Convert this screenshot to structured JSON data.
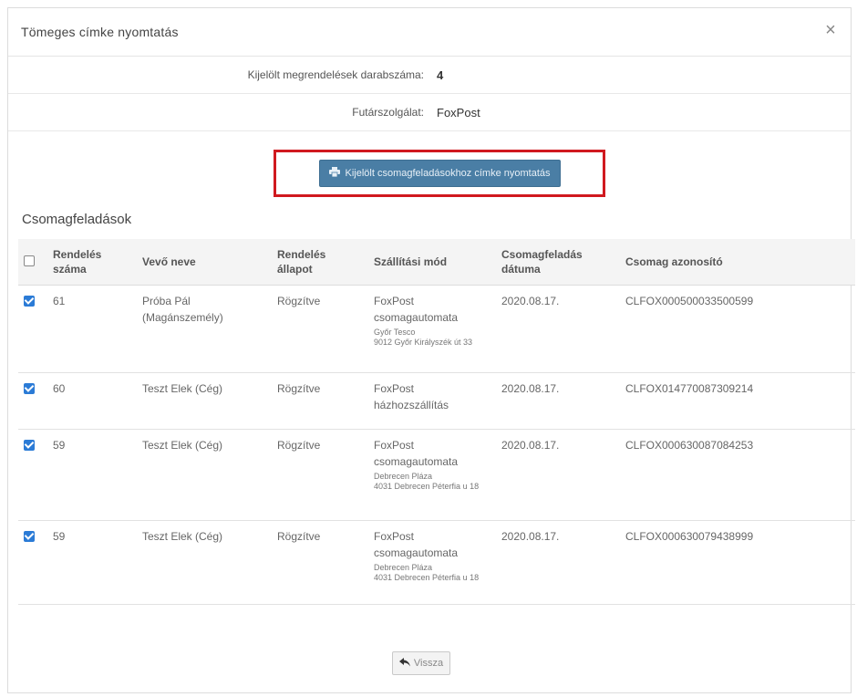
{
  "modal": {
    "title": "Tömeges címke nyomtatás",
    "close_label": "×"
  },
  "info": {
    "count_label": "Kijelölt megrendelések darabszáma:",
    "count_value": "4",
    "courier_label": "Futárszolgálat:",
    "courier_value": "FoxPost"
  },
  "print_button": {
    "label": "Kijelölt csomagfeladásokhoz címke nyomtatás",
    "icon": "printer-icon"
  },
  "section_title": "Csomagfeladások",
  "table": {
    "headers": [
      "Rendelés száma",
      "Vevő neve",
      "Rendelés állapot",
      "Szállítási mód",
      "Csomagfeladás dátuma",
      "Csomag azonosító"
    ],
    "header_checked": false,
    "rows": [
      {
        "checked": true,
        "number": "61",
        "name": "Próba Pál (Magánszemély)",
        "state": "Rögzítve",
        "ship": "FoxPost csomagautomata",
        "ship_detail1": "Győr Tesco",
        "ship_detail2": "9012 Győr Királyszék út 33",
        "date": "2020.08.17.",
        "id": "CLFOX000500033500599"
      },
      {
        "checked": true,
        "number": "60",
        "name": "Teszt Elek (Cég)",
        "state": "Rögzítve",
        "ship": "FoxPost házhozszállítás",
        "ship_detail1": "",
        "ship_detail2": "",
        "date": "2020.08.17.",
        "id": "CLFOX014770087309214"
      },
      {
        "checked": true,
        "number": "59",
        "name": "Teszt Elek (Cég)",
        "state": "Rögzítve",
        "ship": "FoxPost csomagautomata",
        "ship_detail1": "Debrecen Pláza",
        "ship_detail2": "4031 Debrecen Péterfia u 18",
        "date": "2020.08.17.",
        "id": "CLFOX000630087084253"
      },
      {
        "checked": true,
        "number": "59",
        "name": "Teszt Elek (Cég)",
        "state": "Rögzítve",
        "ship": "FoxPost csomagautomata",
        "ship_detail1": "Debrecen Pláza",
        "ship_detail2": "4031 Debrecen Péterfia u 18",
        "date": "2020.08.17.",
        "id": "CLFOX000630079438999"
      }
    ]
  },
  "back_button": {
    "label": "Vissza",
    "icon": "back-arrow-icon"
  },
  "colors": {
    "primary_button": "#4a7ea5",
    "highlight_border": "#d0191f",
    "checkbox": "#2b7bd6"
  }
}
